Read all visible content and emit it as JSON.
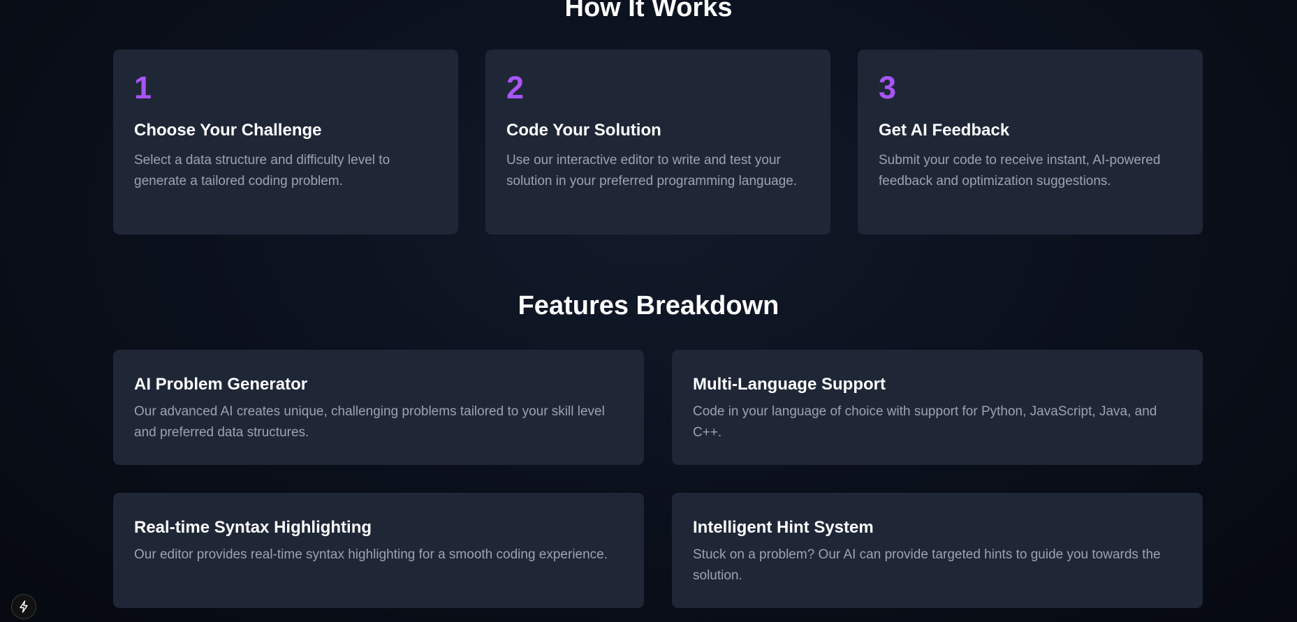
{
  "how_it_works": {
    "title": "How It Works",
    "steps": [
      {
        "number": "1",
        "title": "Choose Your Challenge",
        "description": "Select a data structure and difficulty level to generate a tailored coding problem."
      },
      {
        "number": "2",
        "title": "Code Your Solution",
        "description": "Use our interactive editor to write and test your solution in your preferred programming language."
      },
      {
        "number": "3",
        "title": "Get AI Feedback",
        "description": "Submit your code to receive instant, AI-powered feedback and optimization suggestions."
      }
    ]
  },
  "features": {
    "title": "Features Breakdown",
    "items": [
      {
        "title": "AI Problem Generator",
        "description": "Our advanced AI creates unique, challenging problems tailored to your skill level and preferred data structures."
      },
      {
        "title": "Multi-Language Support",
        "description": "Code in your language of choice with support for Python, JavaScript, Java, and C++."
      },
      {
        "title": "Real-time Syntax Highlighting",
        "description": "Our editor provides real-time syntax highlighting for a smooth coding experience."
      },
      {
        "title": "Intelligent Hint System",
        "description": "Stuck on a problem? Our AI can provide targeted hints to guide you towards the solution."
      }
    ]
  },
  "dev_indicator": {
    "icon": "bolt-icon"
  },
  "colors": {
    "accent": "#a855f7",
    "card_background": "#1f2737",
    "muted_text": "#9ca3af"
  }
}
